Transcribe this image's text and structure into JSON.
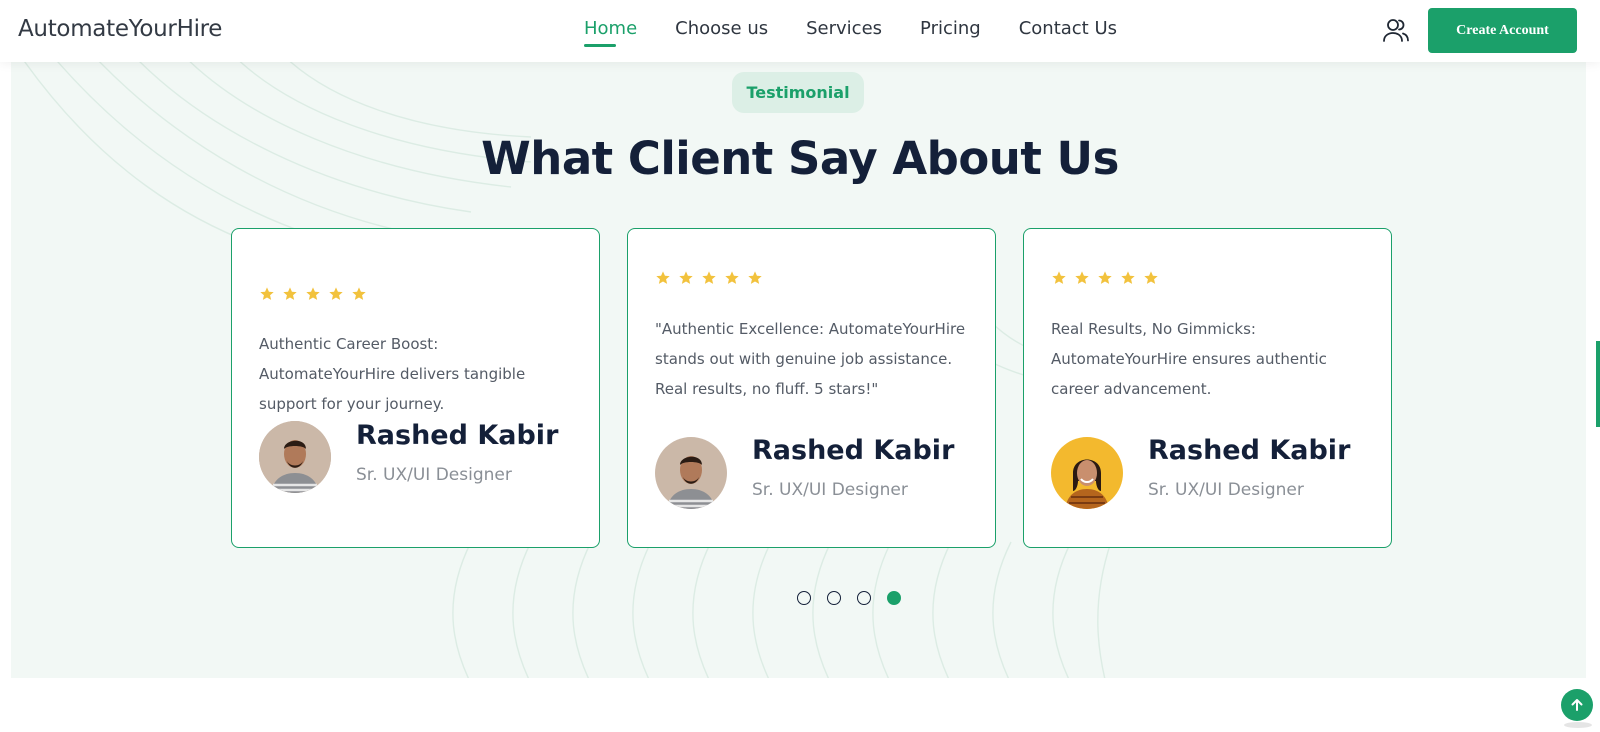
{
  "header": {
    "brand": "AutomateYourHire",
    "nav": [
      {
        "label": "Home",
        "active": true
      },
      {
        "label": "Choose us",
        "active": false
      },
      {
        "label": "Services",
        "active": false
      },
      {
        "label": "Pricing",
        "active": false
      },
      {
        "label": "Contact Us",
        "active": false
      }
    ],
    "user_icon": "users-icon",
    "create_account_label": "Create Account"
  },
  "testimonial": {
    "badge": "Testimonial",
    "title": "What Client Say About Us",
    "cards": [
      {
        "rating": 5,
        "quote": "Authentic Career Boost: AutomateYourHire delivers tangible support for your journey.",
        "name": "Rashed Kabir",
        "role": "Sr. UX/UI Designer"
      },
      {
        "rating": 5,
        "quote": "\"Authentic Excellence: AutomateYourHire stands out with genuine job assistance. Real results, no fluff. 5 stars!\"",
        "name": "Rashed Kabir",
        "role": "Sr. UX/UI Designer"
      },
      {
        "rating": 5,
        "quote": "Real Results, No Gimmicks: AutomateYourHire ensures authentic career advancement.",
        "name": "Rashed Kabir",
        "role": "Sr. UX/UI Designer"
      }
    ],
    "pagination": {
      "total": 4,
      "active": 4
    }
  },
  "colors": {
    "accent": "#1ba06a",
    "heading": "#142039",
    "star": "#f2c23d",
    "section_bg": "#f2f8f5"
  },
  "icons": {
    "star": "star-icon",
    "scroll_top": "arrow-up-icon"
  }
}
